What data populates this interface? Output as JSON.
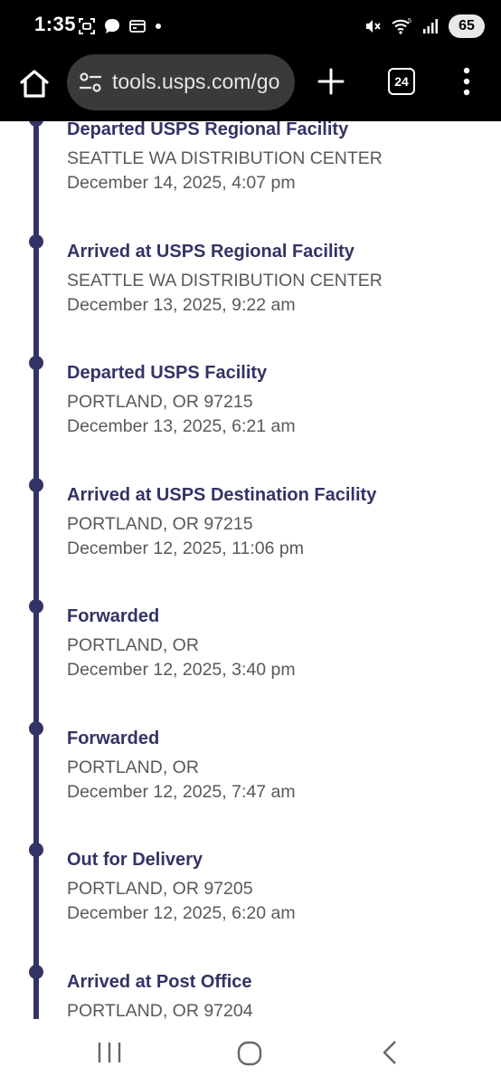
{
  "status_bar": {
    "time": "1:35",
    "battery": "65",
    "left_icons": [
      "screenshot-icon",
      "chat-bubble-icon",
      "wallet-icon",
      "dot-icon"
    ],
    "right_icons": [
      "mute-icon",
      "wifi-icon",
      "signal-icon",
      "battery-icon"
    ]
  },
  "browser": {
    "url": "tools.usps.com/go",
    "tab_count": "24",
    "icons": [
      "home-icon",
      "site-settings-icon",
      "new-tab-plus-icon",
      "tab-switcher-icon",
      "more-menu-icon"
    ]
  },
  "tracking_events": [
    {
      "title": "Departed USPS Regional Facility",
      "location": "SEATTLE WA DISTRIBUTION CENTER",
      "datetime": "December 14, 2025, 4:07 pm"
    },
    {
      "title": "Arrived at USPS Regional Facility",
      "location": "SEATTLE WA DISTRIBUTION CENTER",
      "datetime": "December 13, 2025, 9:22 am"
    },
    {
      "title": "Departed USPS Facility",
      "location": "PORTLAND, OR 97215",
      "datetime": "December 13, 2025, 6:21 am"
    },
    {
      "title": "Arrived at USPS Destination Facility",
      "location": "PORTLAND, OR 97215",
      "datetime": "December 12, 2025, 11:06 pm"
    },
    {
      "title": "Forwarded",
      "location": "PORTLAND, OR",
      "datetime": "December 12, 2025, 3:40 pm"
    },
    {
      "title": "Forwarded",
      "location": "PORTLAND, OR",
      "datetime": "December 12, 2025, 7:47 am"
    },
    {
      "title": "Out for Delivery",
      "location": "PORTLAND, OR 97205",
      "datetime": "December 12, 2025, 6:20 am"
    },
    {
      "title": "Arrived at Post Office",
      "location": "PORTLAND, OR 97204",
      "datetime": ""
    }
  ],
  "colors": {
    "usps_navy": "#333366",
    "secondary_text": "#595959",
    "browser_chrome": "#000000",
    "url_box": "#3a3a3c"
  },
  "nav_bar": {
    "icons": [
      "recent-apps-icon",
      "home-circle-icon",
      "back-chevron-icon"
    ]
  }
}
